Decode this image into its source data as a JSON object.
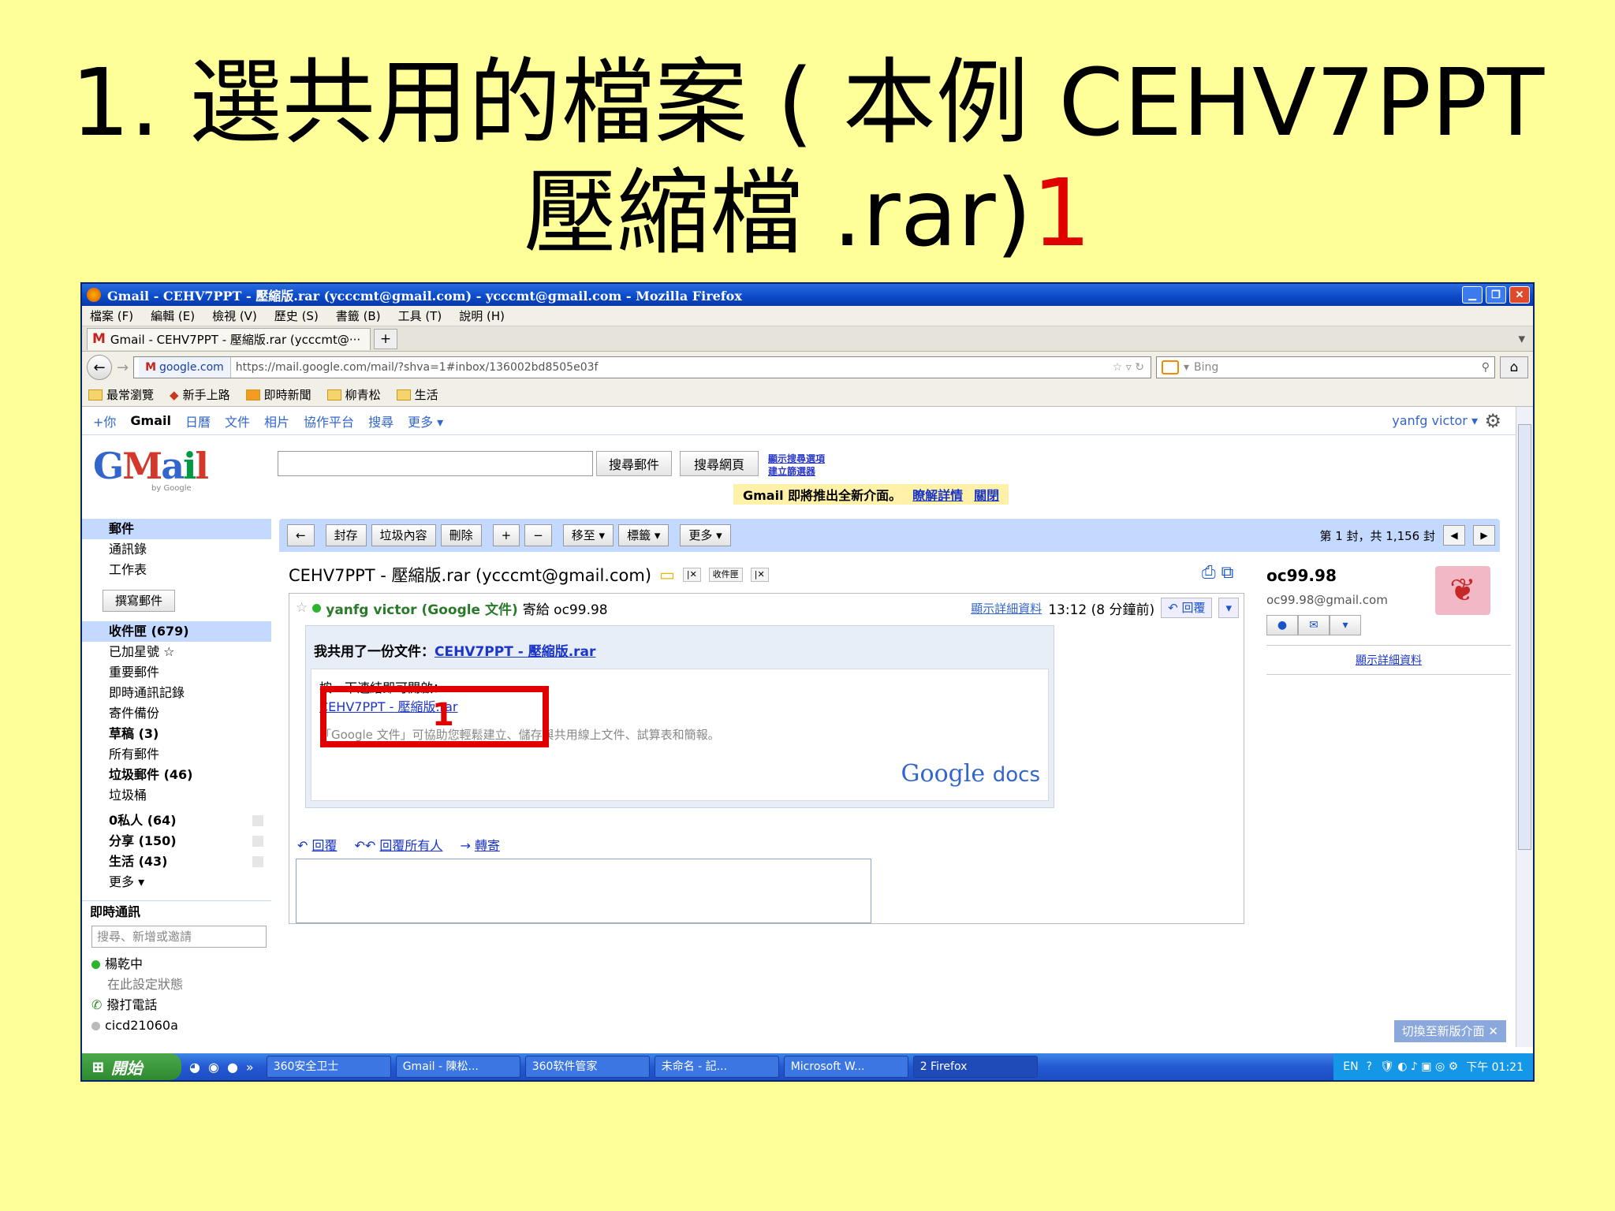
{
  "slide": {
    "title_line1": "1. 選共用的檔案 ( 本例 CEHV7PPT",
    "title_line2": "壓縮檔 .rar)",
    "title_mark": "1"
  },
  "window": {
    "title": "Gmail - CEHV7PPT - 壓縮版.rar (ycccmt@gmail.com) - ycccmt@gmail.com - Mozilla Firefox",
    "menu": [
      "檔案 (F)",
      "編輯 (E)",
      "檢視 (V)",
      "歷史 (S)",
      "書籤 (B)",
      "工具 (T)",
      "說明 (H)"
    ],
    "tab_label": "Gmail - CEHV7PPT - 壓縮版.rar (ycccmt@···",
    "new_tab": "+",
    "site_badge": "google.com",
    "url": "https://mail.google.com/mail/?shva=1#inbox/136002bd8505e03f",
    "search_placeholder": "Bing",
    "bookmarks": [
      "最常瀏覽",
      "新手上路",
      "即時新聞",
      "柳青松",
      "生活"
    ]
  },
  "gbar": {
    "items": [
      "+你",
      "Gmail",
      "日曆",
      "文件",
      "相片",
      "協作平台",
      "搜尋",
      "更多 ▾"
    ],
    "user": "yanfg victor ▾"
  },
  "gmail": {
    "logo_sub": "by Google",
    "search_mail": "搜尋郵件",
    "search_web": "搜尋網頁",
    "small_links": [
      "顯示搜尋選項",
      "建立篩選器"
    ],
    "notice": "Gmail 即將推出全新介面。",
    "notice_link1": "瞭解詳情",
    "notice_link2": "關閉"
  },
  "leftnav": {
    "top": [
      "郵件",
      "通訊錄",
      "工作表"
    ],
    "compose": "撰寫郵件",
    "folders": [
      {
        "label": "收件匣 (679)",
        "sel": true,
        "bold": true
      },
      {
        "label": "已加星號 ☆"
      },
      {
        "label": "重要郵件"
      },
      {
        "label": "即時通訊記錄"
      },
      {
        "label": "寄件備份"
      },
      {
        "label": "草稿 (3)",
        "bold": true
      },
      {
        "label": "所有郵件"
      },
      {
        "label": "垃圾郵件 (46)",
        "bold": true
      },
      {
        "label": "垃圾桶"
      }
    ],
    "labels": [
      "0私人 (64)",
      "分享 (150)",
      "生活 (43)"
    ],
    "more": "更多 ▾",
    "chat_header": "即時通訊",
    "chat_search": "搜尋、新增或邀請",
    "chat_user": "楊乾中",
    "chat_status": "在此設定狀態",
    "call": "撥打電話",
    "contact": "cicd21060a"
  },
  "toolbar": {
    "back": "←",
    "buttons": [
      "封存",
      "垃圾內容",
      "刪除"
    ],
    "icon_buttons": [
      "+",
      "−"
    ],
    "move": "移至 ▾",
    "labels": "標籤 ▾",
    "more": "更多 ▾",
    "pager": "第 1 封，共 1,156 封"
  },
  "message": {
    "subject": "CEHV7PPT - 壓縮版.rar (ycccmt@gmail.com)",
    "tag1": "收件匣",
    "sender": "yanfg victor (Google 文件)",
    "to": "寄給 oc99.98",
    "show_details": "顯示詳細資料",
    "time": "13:12 (8 分鐘前)",
    "reply_btn": "回覆",
    "shared_text": "我共用了一份文件：",
    "shared_link": "CEHV7PPT - 壓縮版.rar",
    "click_hint": "按一下連結即可開啟：",
    "file_link": "CEHV7PPT - 壓縮版.rar",
    "docs_hint": "「Google 文件」可協助您輕鬆建立、儲存與共用線上文件、試算表和簡報。",
    "docs_logo": "Google",
    "docs_word": "docs",
    "annotation": "1",
    "reply": "回覆",
    "reply_all": "回覆所有人",
    "forward": "轉寄"
  },
  "contact": {
    "name": "oc99.98",
    "email": "oc99.98@gmail.com",
    "details": "顯示詳細資料"
  },
  "switch": "切換至新版介面 ✕",
  "taskbar": {
    "start": "開始",
    "tasks": [
      "360安全卫士",
      "Gmail - 陳松...",
      "360软件管家",
      "未命名 - 記...",
      "Microsoft W...",
      "2 Firefox"
    ],
    "lang": "EN",
    "clock": "下午 01:21"
  }
}
